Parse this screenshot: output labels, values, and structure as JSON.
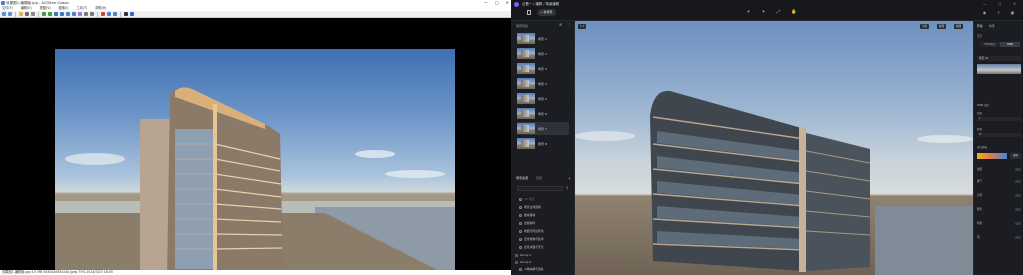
{
  "viewer": {
    "title": "效果图1-编辑版.jpg - ACDSee Classic",
    "window_controls": [
      "—",
      "□",
      "✕"
    ],
    "menu": [
      "文件(F)",
      "编辑(E)",
      "视图(V)",
      "图像(I)",
      "工具(T)",
      "帮助(H)"
    ],
    "status": "效果图1-编辑版.jpg  4.5 MB  5040x2835x24b jpeg  75%  2024/3/23 18:05"
  },
  "editor": {
    "title": "云看一 / 编辑 / 场景编辑",
    "window_controls": [
      "—",
      "□",
      "✕"
    ],
    "new_scene_label": "新场景",
    "scenes_header": "场景列表",
    "scenes": [
      {
        "label": "场景 1"
      },
      {
        "label": "场景 2"
      },
      {
        "label": "场景 3"
      },
      {
        "label": "场景 4"
      },
      {
        "label": "场景 5"
      },
      {
        "label": "场景 6"
      },
      {
        "label": "场景 7"
      },
      {
        "label": "场景 8"
      }
    ],
    "layers_tab_1": "场景资源",
    "layers_tab_2": "灯光",
    "layers": [
      {
        "label": "3D 模型",
        "dim": true
      },
      {
        "label": "场景主体建筑"
      },
      {
        "label": "玻璃幕墙"
      },
      {
        "label": "金属构件"
      },
      {
        "label": "地面与周边环境"
      },
      {
        "label": "近景植物与装饰"
      },
      {
        "label": "远景水面与天空"
      },
      {
        "label": "Group 1"
      },
      {
        "label": "Group 2"
      },
      {
        "label": "人物车辆与道具"
      }
    ],
    "viewport_buttons": [
      "渲染",
      "截图",
      "视图"
    ],
    "props": {
      "tab_1": "环境",
      "tab_2": "效果",
      "section_env": "天空",
      "seg_left": "HDRI天空",
      "seg_right": "HDRI",
      "selected_hdri": "晴天 01",
      "hdri_label": "HDRI 天空",
      "brightness_label": "亮度",
      "brightness_value": "1",
      "rotation_label": "旋转",
      "rotation_value": "0°",
      "color_label": "天空颜色",
      "edit_label": "编辑",
      "rows": [
        "太阳",
        "雾气",
        "光晕",
        "曝光",
        "阴影",
        "风"
      ]
    }
  }
}
